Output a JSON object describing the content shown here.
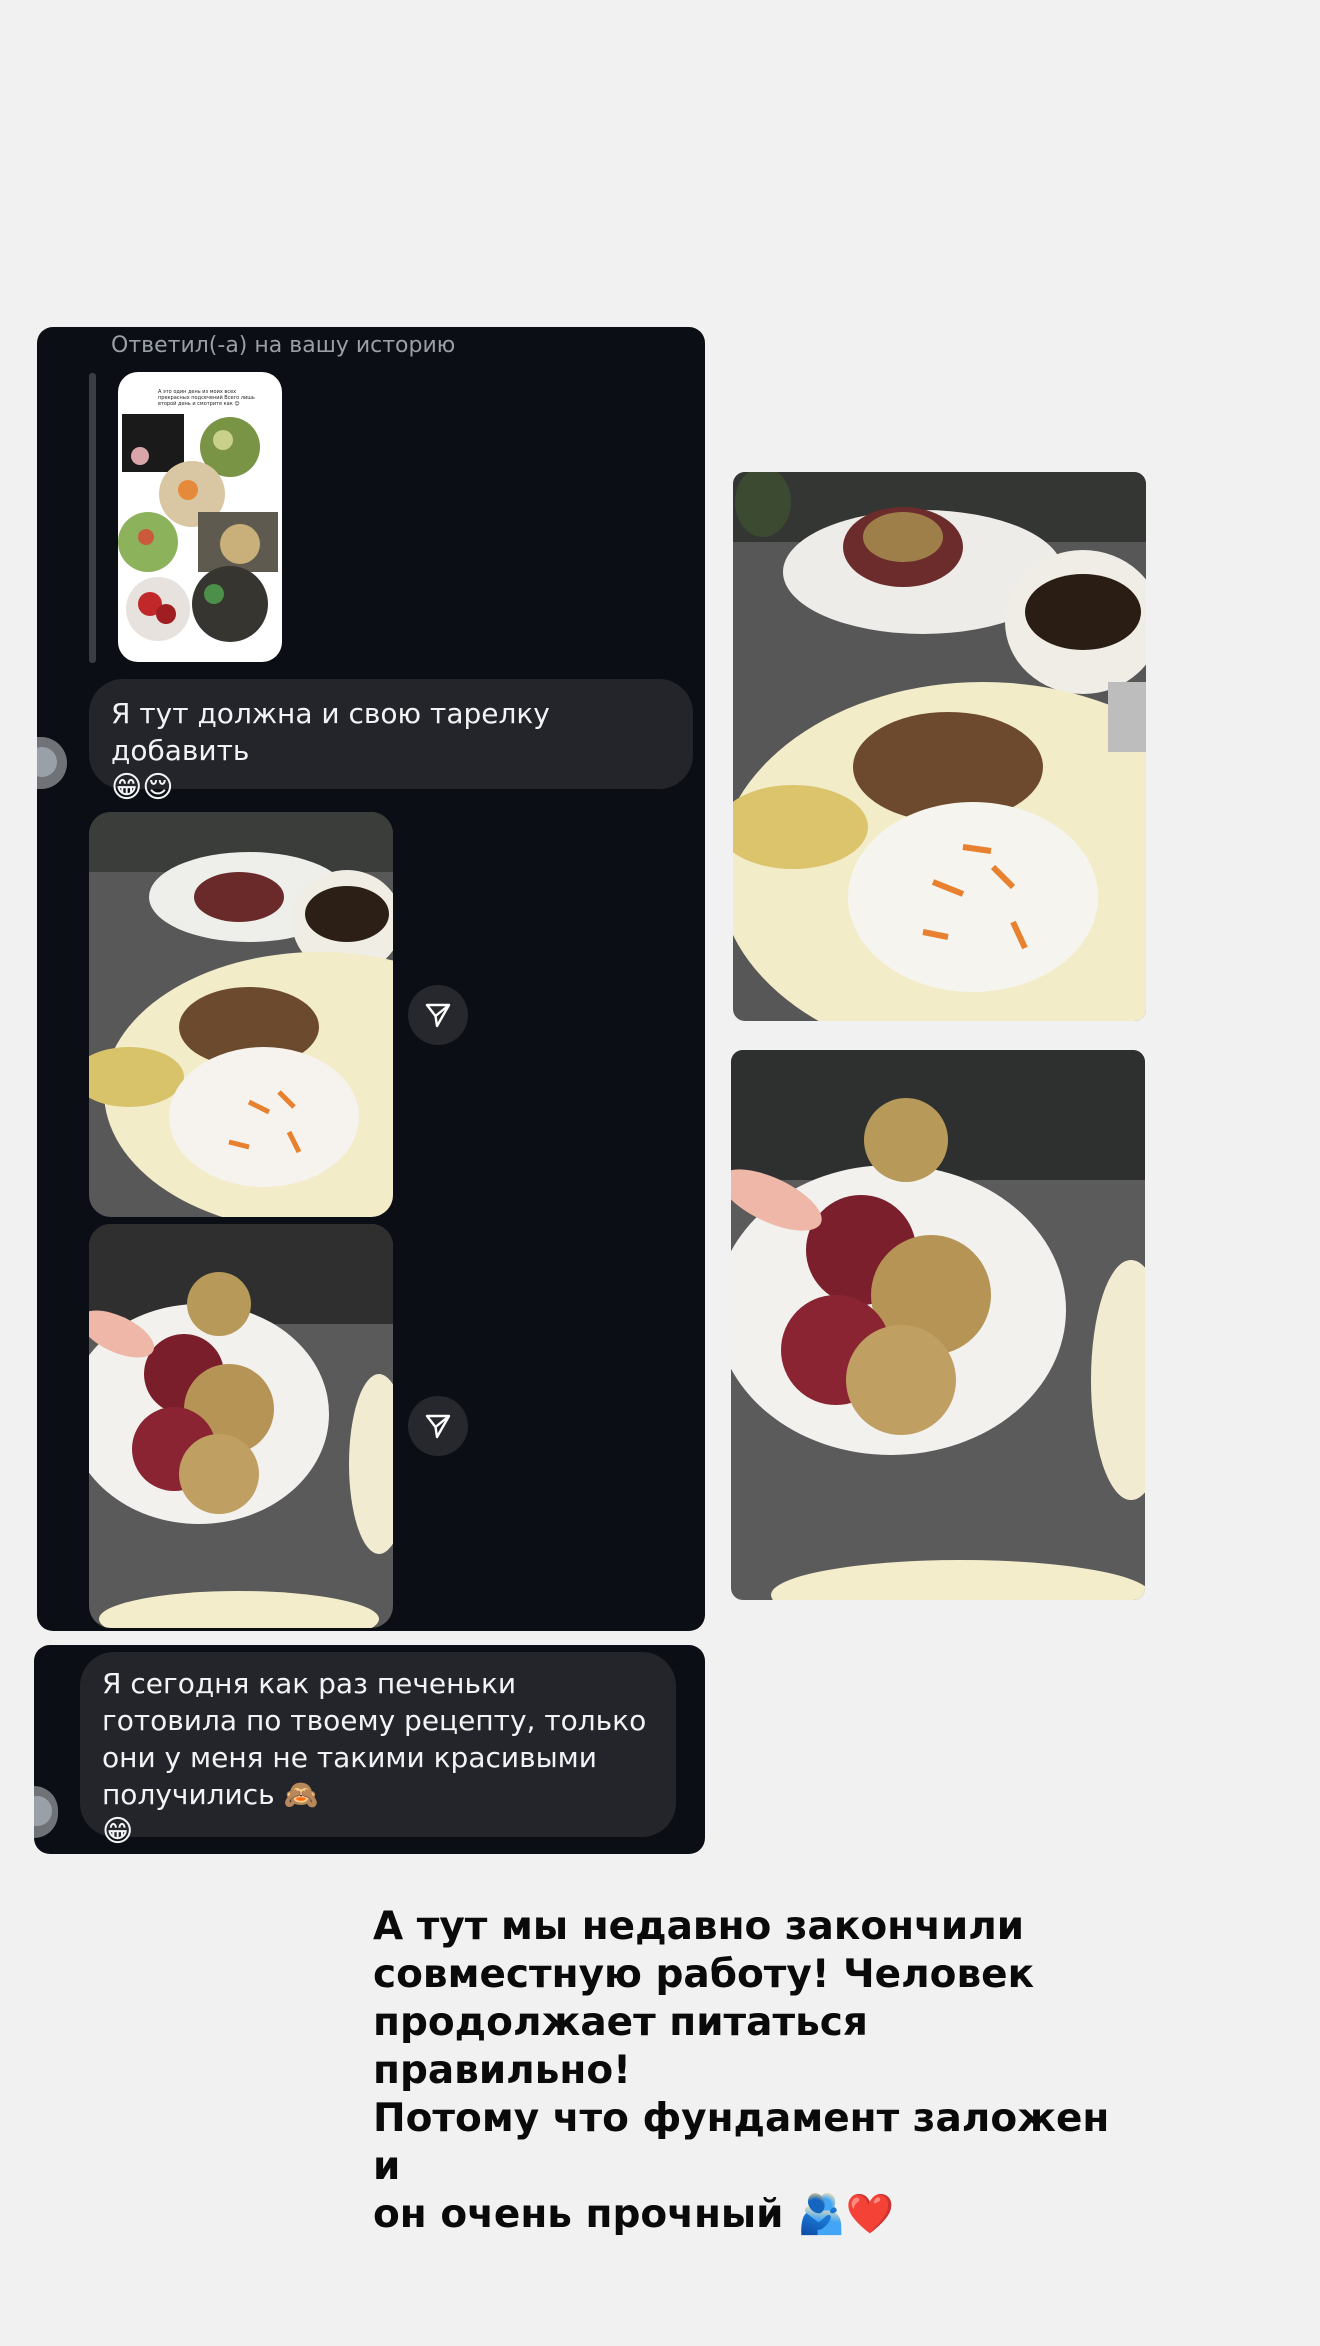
{
  "chat": {
    "reply_label": "Ответил(-а) на вашу историю",
    "message_1": "Я тут должна и свою тарелку добавить",
    "message_1_emoji": "😁😌",
    "message_2": "Я сегодня как раз печеньки готовила по твоему рецепту, только они у меня не такими красивыми получились 🙈",
    "message_2_emoji": "😁"
  },
  "story_preview": {
    "text": "А это один день из моих всех прекрасных подсечений Всего лишь второй день и смотрите как 😊"
  },
  "caption": {
    "text": "А тут мы недавно закончили\nсовместную работу! Человек\nпродолжает питаться правильно!\nПотому что фундамент заложен  и\nон очень прочный 🫂❤️"
  },
  "icons": {
    "share": "send-arrow-icon"
  },
  "colors": {
    "panel": "#0b0e14",
    "bubble": "#23252a",
    "page": "#f1f1f1"
  }
}
